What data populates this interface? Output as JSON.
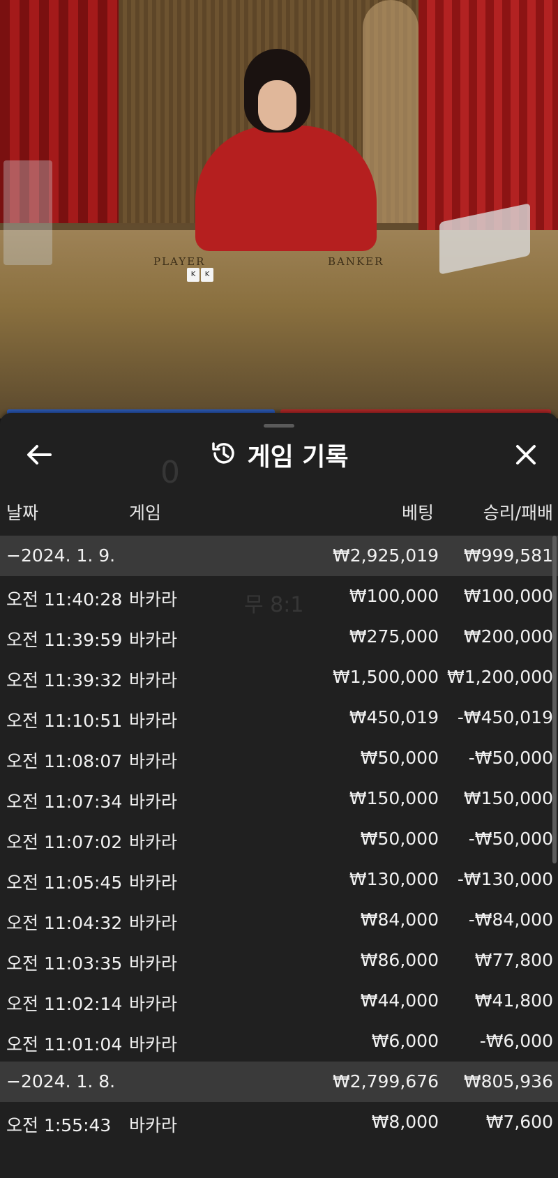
{
  "sheet": {
    "title": "게임 기록",
    "icons": {
      "back": "back-arrow-icon",
      "history": "history-icon",
      "close": "close-icon"
    }
  },
  "table_labels": {
    "player": "PLAYER",
    "banker": "BANKER"
  },
  "columns": {
    "date": "날짜",
    "game": "게임",
    "bet": "베팅",
    "result": "승리/패배"
  },
  "groups": [
    {
      "date": "−2024. 1. 9.",
      "total_bet": "₩2,925,019",
      "total_result": "₩999,581",
      "rows": [
        {
          "time": "오전 11:40:28",
          "game": "바카라",
          "bet": "₩100,000",
          "result": "₩100,000"
        },
        {
          "time": "오전 11:39:59",
          "game": "바카라",
          "bet": "₩275,000",
          "result": "₩200,000"
        },
        {
          "time": "오전 11:39:32",
          "game": "바카라",
          "bet": "₩1,500,000",
          "result": "₩1,200,000"
        },
        {
          "time": "오전 11:10:51",
          "game": "바카라",
          "bet": "₩450,019",
          "result": "-₩450,019"
        },
        {
          "time": "오전 11:08:07",
          "game": "바카라",
          "bet": "₩50,000",
          "result": "-₩50,000"
        },
        {
          "time": "오전 11:07:34",
          "game": "바카라",
          "bet": "₩150,000",
          "result": "₩150,000"
        },
        {
          "time": "오전 11:07:02",
          "game": "바카라",
          "bet": "₩50,000",
          "result": "-₩50,000"
        },
        {
          "time": "오전 11:05:45",
          "game": "바카라",
          "bet": "₩130,000",
          "result": "-₩130,000"
        },
        {
          "time": "오전 11:04:32",
          "game": "바카라",
          "bet": "₩84,000",
          "result": "-₩84,000"
        },
        {
          "time": "오전 11:03:35",
          "game": "바카라",
          "bet": "₩86,000",
          "result": "₩77,800"
        },
        {
          "time": "오전 11:02:14",
          "game": "바카라",
          "bet": "₩44,000",
          "result": "₩41,800"
        },
        {
          "time": "오전 11:01:04",
          "game": "바카라",
          "bet": "₩6,000",
          "result": "-₩6,000"
        }
      ]
    },
    {
      "date": "−2024. 1. 8.",
      "total_bet": "₩2,799,676",
      "total_result": "₩805,936",
      "rows": [
        {
          "time": "오전 1:55:43",
          "game": "바카라",
          "bet": "₩8,000",
          "result": "₩7,600"
        }
      ]
    }
  ]
}
